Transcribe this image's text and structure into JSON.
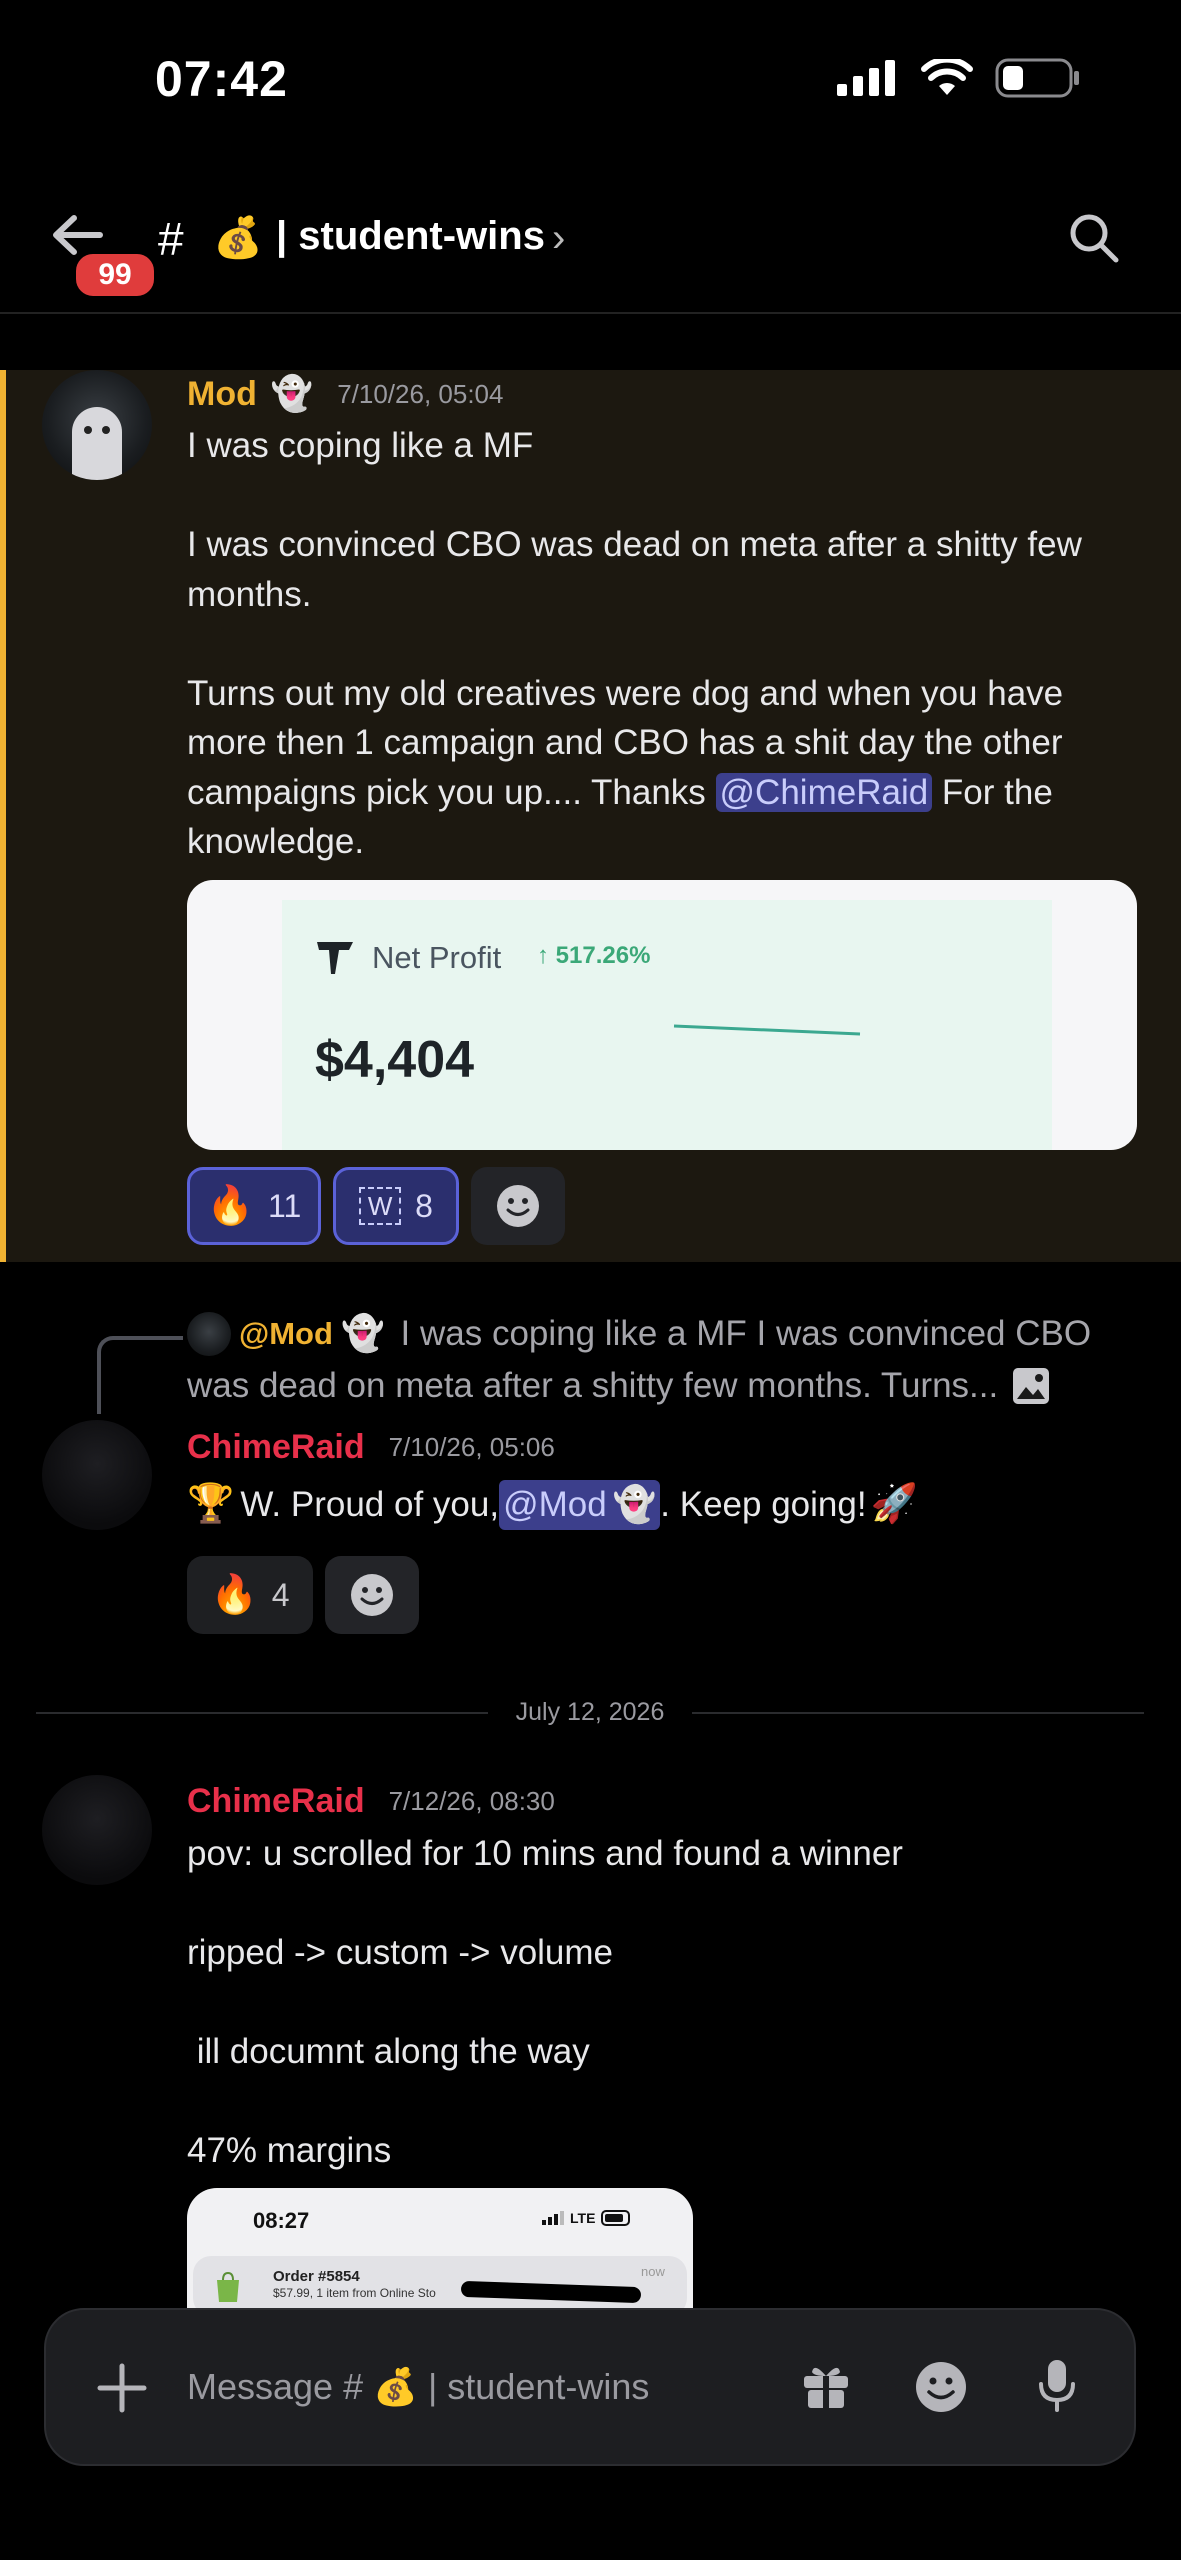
{
  "status_bar": {
    "time": "07:42"
  },
  "header": {
    "back_badge": "99",
    "hash": "#",
    "channel_emoji": "💰",
    "channel_name": "| student-wins",
    "chevron": "›"
  },
  "messages": [
    {
      "author": "Mod",
      "author_emoji": "👻",
      "timestamp": "7/10/26, 05:04",
      "lines": [
        "I was coping like a MF",
        "",
        "I was convinced CBO was dead on meta after a shitty few",
        "months.",
        "",
        "Turns out my old creatives were dog  and when you have",
        "more then 1 campaign and CBO has a shit day the other"
      ],
      "last_line_before": "campaigns pick you up.... Thanks ",
      "last_line_mention": "@ChimeRaid",
      "last_line_after": " For the",
      "final_line": "knowledge.",
      "embed": {
        "label": "Net Profit",
        "arrow": "↑",
        "percent": "517.26%",
        "value": "$4,404"
      },
      "reactions": [
        {
          "emoji": "🔥",
          "count": "11"
        },
        {
          "emoji": "W",
          "count": "8"
        }
      ]
    },
    {
      "reply_preview": {
        "mention": "@Mod",
        "emoji": "👻",
        "text_line1": "I was coping like a MF   I was convinced CBO",
        "text_line2": "was dead on meta after a shitty few months.   Turns..."
      },
      "author": "ChimeRaid",
      "timestamp": "7/10/26, 05:06",
      "text_before": "W. Proud of you, ",
      "mention": "@Mod",
      "mention_emoji": "👻",
      "text_after": " . Keep going!",
      "lead_emoji": "🏆",
      "tail_emoji": "🚀",
      "reactions": [
        {
          "emoji": "🔥",
          "count": "4"
        }
      ]
    },
    {
      "author": "ChimeRaid",
      "timestamp": "7/12/26, 08:30",
      "lines": [
        "pov: u scrolled for 10 mins and found a winner",
        "",
        "ripped -> custom -> volume",
        "",
        " ill documnt along the way",
        "",
        "47% margins"
      ],
      "attachment": {
        "time": "08:27",
        "network": "LTE",
        "order": "Order #5854",
        "order_sub": "$57.99, 1 item from Online Sto",
        "when": "now"
      }
    }
  ],
  "date_divider": "July 12, 2026",
  "composer": {
    "placeholder_prefix": "Message #",
    "placeholder_emoji": "💰",
    "placeholder_suffix": "| student-wins"
  },
  "colors": {
    "mod_name": "#f0b232",
    "chime_name": "#e8304a",
    "highlight_bg": "#1c1810",
    "mention_bg": "#3c3f8c"
  }
}
